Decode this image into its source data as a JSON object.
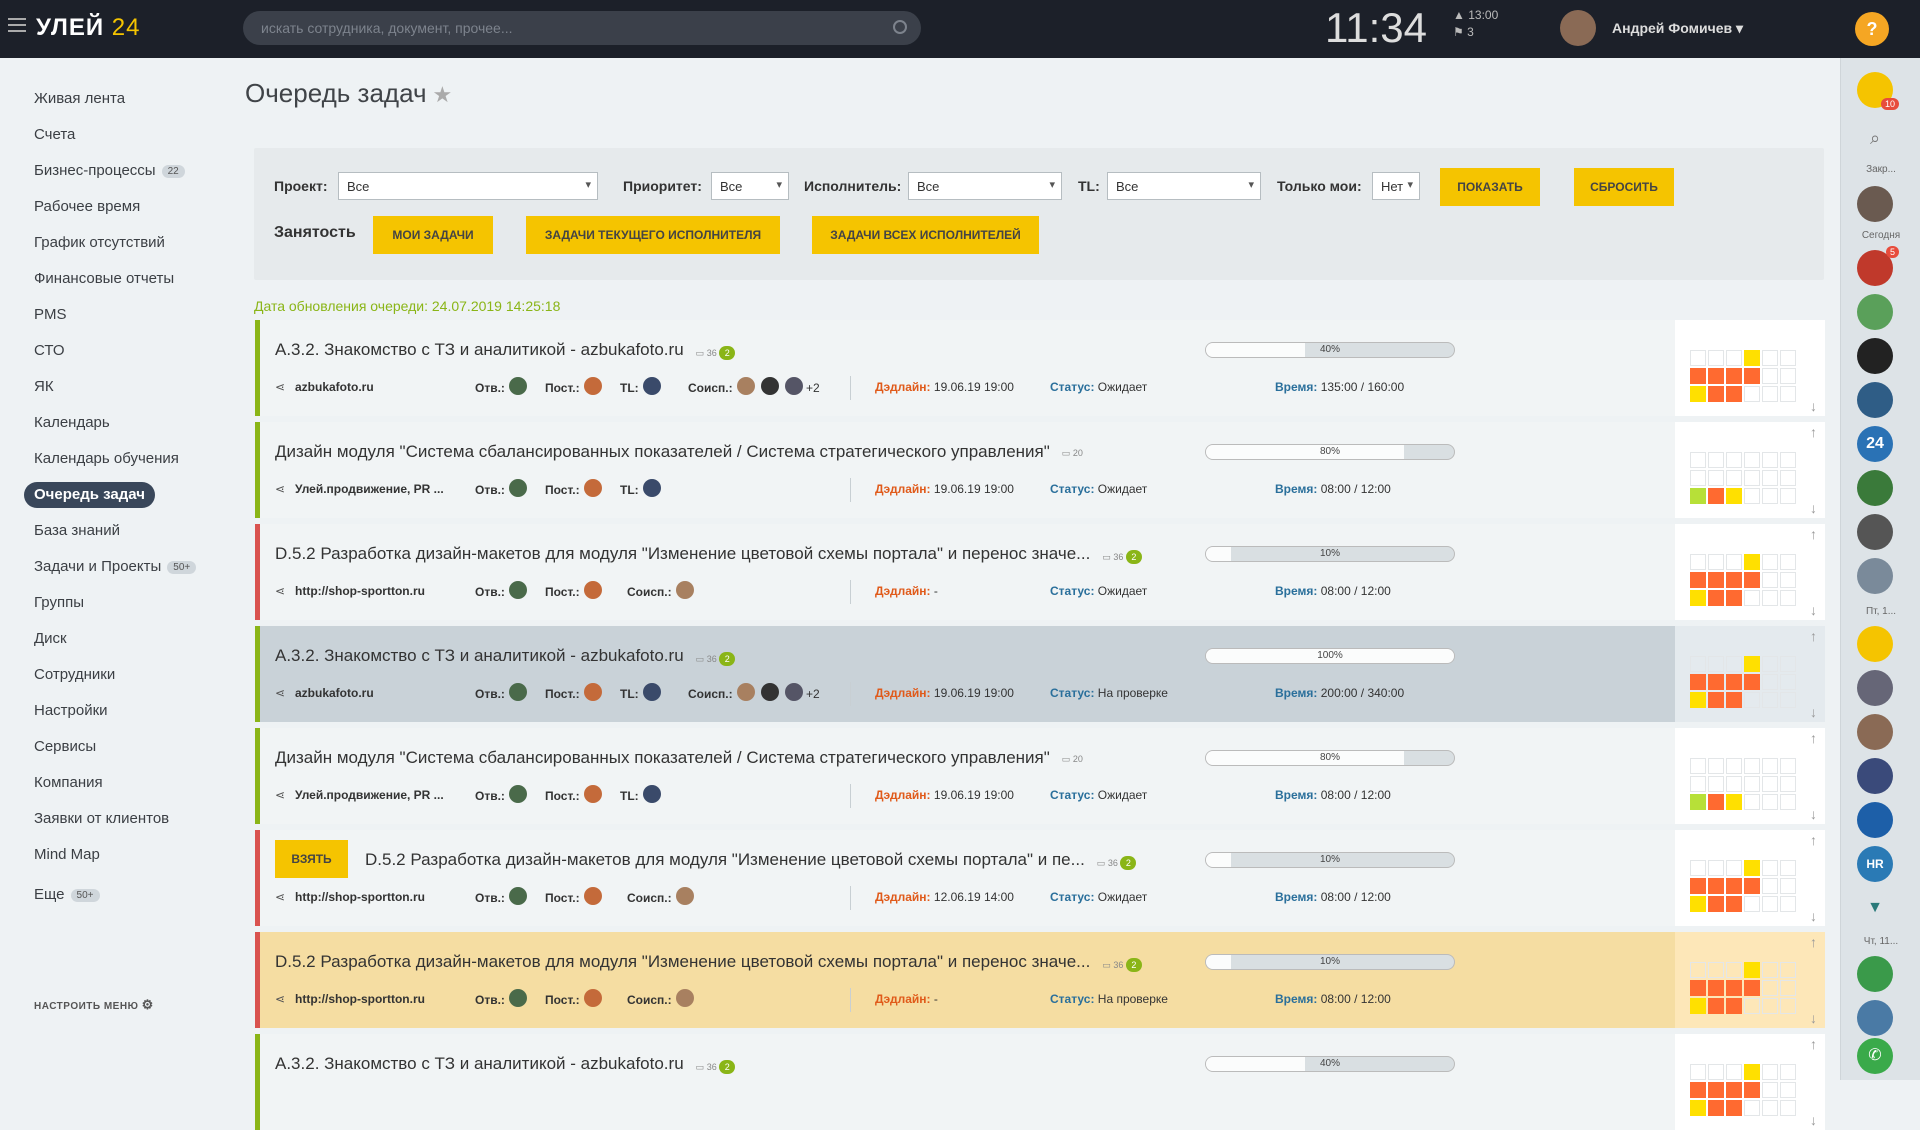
{
  "header": {
    "logo_main": "УЛЕЙ",
    "logo_num": "24",
    "search_placeholder": "искать сотрудника, документ, прочее...",
    "time": "11:34",
    "sys_time": "13:00",
    "sys_flags": "3",
    "user_name": "Андрей Фомичев",
    "help": "?"
  },
  "sidebar": {
    "items": [
      {
        "label": "Живая лента"
      },
      {
        "label": "Счета"
      },
      {
        "label": "Бизнес-процессы",
        "count": "22"
      },
      {
        "label": "Рабочее время"
      },
      {
        "label": "График отсутствий"
      },
      {
        "label": "Финансовые отчеты"
      },
      {
        "label": "PMS"
      },
      {
        "label": "СТО"
      },
      {
        "label": "ЯК"
      },
      {
        "label": "Календарь"
      },
      {
        "label": "Календарь обучения"
      },
      {
        "label": "Очередь задач",
        "active": true
      },
      {
        "label": "База знаний"
      },
      {
        "label": "Задачи и Проекты",
        "count": "50+"
      },
      {
        "label": "Группы"
      },
      {
        "label": "Диск"
      },
      {
        "label": "Сотрудники"
      },
      {
        "label": "Настройки"
      },
      {
        "label": "Сервисы"
      },
      {
        "label": "Компания"
      },
      {
        "label": "Заявки от клиентов"
      },
      {
        "label": "Mind Map"
      },
      {
        "label": "Еще",
        "count": "50+"
      }
    ],
    "configure": "НАСТРОИТЬ МЕНЮ"
  },
  "page": {
    "title": "Очередь задач",
    "updated": "Дата обновления очереди: 24.07.2019 14:25:18"
  },
  "filters": {
    "project_label": "Проект:",
    "project_value": "Все",
    "priority_label": "Приоритет:",
    "priority_value": "Все",
    "executor_label": "Исполнитель:",
    "executor_value": "Все",
    "tl_label": "TL:",
    "tl_value": "Все",
    "only_mine_label": "Только мои:",
    "only_mine_value": "Нет",
    "show_button": "ПОКАЗАТЬ",
    "reset_button": "СБРОСИТЬ",
    "busy_label": "Занятость",
    "my_tasks_button": "МОИ ЗАДАЧИ",
    "current_exec_button": "ЗАДАЧИ ТЕКУЩЕГО ИСПОЛНИТЕЛЯ",
    "all_exec_button": "ЗАДАЧИ ВСЕХ ИСПОЛНИТЕЛЕЙ"
  },
  "labels": {
    "otv": "Отв.:",
    "post": "Пост.:",
    "tl": "TL:",
    "soisp": "Соисп.:",
    "deadline": "Дэдлайн:",
    "status": "Статус:",
    "time": "Время:",
    "take": "ВЗЯТЬ"
  },
  "tasks": [
    {
      "title": "А.3.2. Знакомство с ТЗ и аналитикой - azbukafoto.ru",
      "comments": "36",
      "badge": "2",
      "project": "azbukafoto.ru",
      "has_tl": true,
      "has_soisp": true,
      "extra": "+2",
      "deadline": "19.06.19 19:00",
      "status": "Ожидает",
      "time": "135:00 / 160:00",
      "progress": "40%",
      "color": "green",
      "bg": "normal"
    },
    {
      "title": "Дизайн модуля \"Система сбалансированных показателей / Система стратегического управления\"",
      "comments": "20",
      "badge": "",
      "project": "Улей.продвижение, PR ...",
      "has_tl": true,
      "has_soisp": false,
      "extra": "",
      "deadline": "19.06.19 19:00",
      "status": "Ожидает",
      "time": "08:00 / 12:00",
      "progress": "80%",
      "color": "green",
      "bg": "normal"
    },
    {
      "title": "D.5.2 Разработка дизайн-макетов для модуля \"Изменение цветовой схемы портала\" и перенос значе...",
      "comments": "36",
      "badge": "2",
      "project": "http://shop-sportton.ru",
      "has_tl": false,
      "has_soisp": true,
      "extra": "",
      "deadline": "-",
      "status": "Ожидает",
      "time": "08:00 / 12:00",
      "progress": "10%",
      "color": "red",
      "bg": "normal"
    },
    {
      "title": "А.3.2. Знакомство с ТЗ и аналитикой - azbukafoto.ru",
      "comments": "36",
      "badge": "2",
      "project": "azbukafoto.ru",
      "has_tl": true,
      "has_soisp": true,
      "extra": "+2",
      "deadline": "19.06.19 19:00",
      "status": "На проверке",
      "time": "200:00 / 340:00",
      "progress": "100%",
      "color": "green",
      "bg": "gray"
    },
    {
      "title": "Дизайн модуля \"Система сбалансированных показателей / Система стратегического управления\"",
      "comments": "20",
      "badge": "",
      "project": "Улей.продвижение, PR ...",
      "has_tl": true,
      "has_soisp": false,
      "extra": "",
      "deadline": "19.06.19 19:00",
      "status": "Ожидает",
      "time": "08:00 / 12:00",
      "progress": "80%",
      "color": "green",
      "bg": "normal"
    },
    {
      "title": "D.5.2 Разработка дизайн-макетов для модуля \"Изменение цветовой схемы портала\" и пе...",
      "comments": "36",
      "badge": "2",
      "project": "http://shop-sportton.ru",
      "has_tl": false,
      "has_soisp": true,
      "extra": "",
      "deadline": "12.06.19 14:00",
      "status": "Ожидает",
      "time": "08:00 / 12:00",
      "progress": "10%",
      "color": "red",
      "bg": "normal",
      "take": true
    },
    {
      "title": "D.5.2 Разработка дизайн-макетов для модуля \"Изменение цветовой схемы портала\" и перенос значе...",
      "comments": "36",
      "badge": "2",
      "project": "http://shop-sportton.ru",
      "has_tl": false,
      "has_soisp": true,
      "extra": "",
      "deadline": "-",
      "status": "На проверке",
      "time": "08:00 / 12:00",
      "progress": "10%",
      "color": "red",
      "bg": "yellow"
    },
    {
      "title": "А.3.2. Знакомство с ТЗ и аналитикой - azbukafoto.ru",
      "comments": "36",
      "badge": "2",
      "project": "",
      "has_tl": false,
      "has_soisp": false,
      "extra": "",
      "deadline": "",
      "status": "",
      "time": "",
      "progress": "40%",
      "color": "green",
      "bg": "normal"
    }
  ],
  "rightbar": {
    "closed_label": "Закр...",
    "today_label": "Сегодня",
    "fri_label": "Пт, 1...",
    "thu_label": "Чт, 11...",
    "notif_count": "10",
    "chat_count": "5"
  },
  "colors": {
    "accent": "#f5c400",
    "green": "#8ab517",
    "red": "#d9534f",
    "orange": "#ff6a30",
    "yellow": "#ffe000"
  }
}
